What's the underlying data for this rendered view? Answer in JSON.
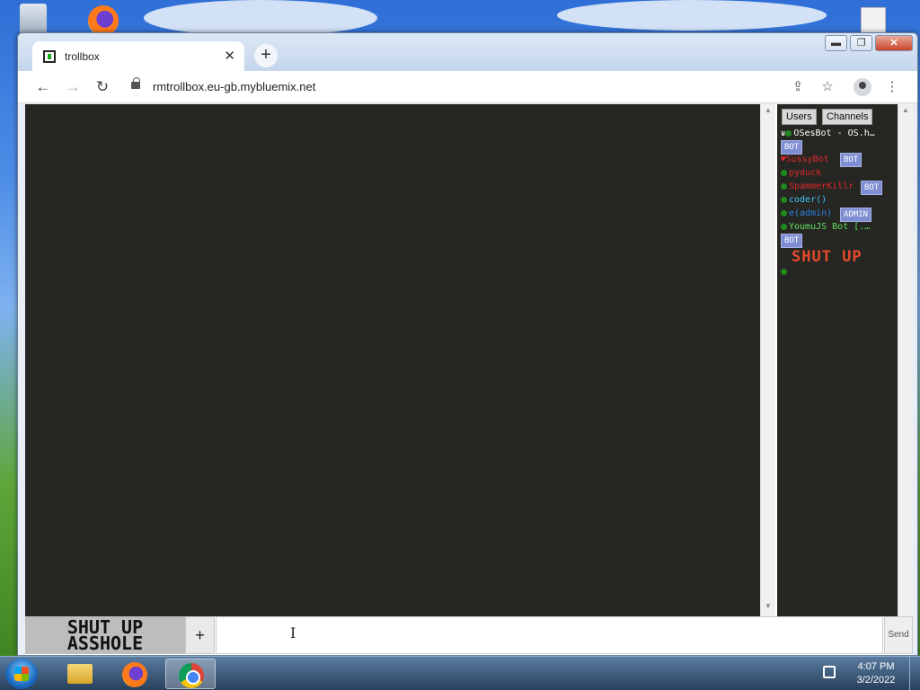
{
  "browser": {
    "tab_title": "trollbox",
    "tab_close": "✕",
    "new_tab": "+",
    "url": "rmtrollbox.eu-gb.mybluemix.net",
    "window_controls": {
      "minimize": "▬",
      "restore": "❐",
      "close": "✕"
    },
    "icons": {
      "back": "←",
      "forward": "→",
      "reload": "↻",
      "share": "⇪",
      "star": "☆",
      "menu": "⋮"
    }
  },
  "sidebar": {
    "tabs": [
      "Users",
      "Channels"
    ],
    "users": [
      {
        "name": "OSesBot - OS.h…",
        "color": "#ffffff",
        "icon": "crown",
        "badge": "BOT"
      },
      {
        "name": "SussyBot",
        "color": "#e0282d",
        "icon": "heart",
        "badge": "BOT"
      },
      {
        "name": "pyduck",
        "color": "#e0282d",
        "icon": "dot"
      },
      {
        "name": "SpammerKillr",
        "color": "#e0282d",
        "icon": "dot",
        "badge": "BOT"
      },
      {
        "name": "coder()",
        "color": "#3fc7ff",
        "icon": "dot"
      },
      {
        "name": "e(admin)",
        "color": "#2e7ee6",
        "icon": "dot",
        "badge": "ADMIN"
      },
      {
        "name": "YoumuJS Bot [.…",
        "color": "#5fe05f",
        "icon": "dot",
        "badge": "BOT"
      }
    ],
    "shout": "SHUT UP"
  },
  "input_bar": {
    "nick_line1": "SHUT UP",
    "nick_line2": "ASSHOLE",
    "plus": "+",
    "message_value": "",
    "send_label": "Send"
  },
  "taskbar": {
    "time": "4:07 PM",
    "date": "3/2/2022"
  },
  "colors": {
    "chat_bg": "#262622",
    "badge": "#7f8ed3",
    "shout": "#e5492a"
  }
}
